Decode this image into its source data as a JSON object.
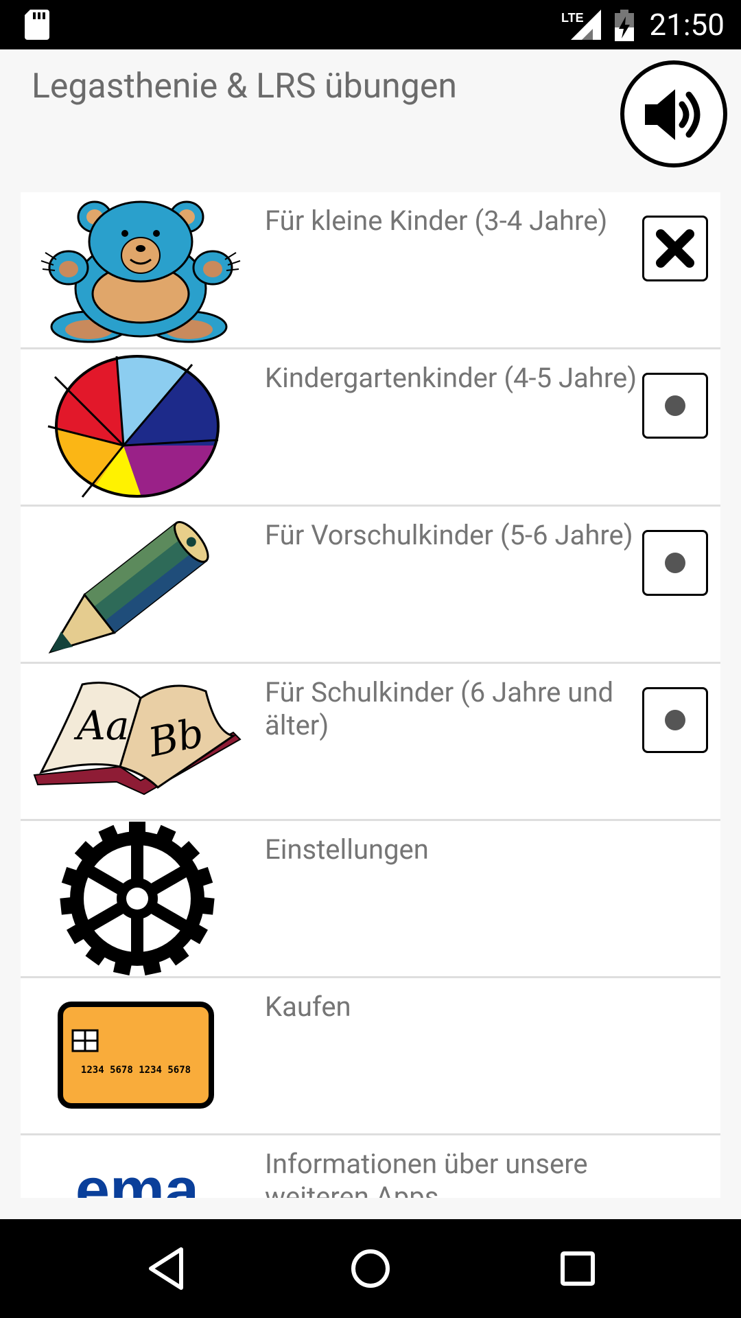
{
  "status_bar": {
    "time": "21:50",
    "network": "LTE"
  },
  "app": {
    "title": "Legasthenie & LRS übungen"
  },
  "menu": [
    {
      "label": "Für kleine Kinder (3-4 Jahre)",
      "icon": "teddy-bear-icon",
      "checkbox": "selected-x"
    },
    {
      "label": "Kindergartenkinder (4-5 Jahre)",
      "icon": "ball-icon",
      "checkbox": "dot"
    },
    {
      "label": "Für Vorschulkinder (5-6 Jahre)",
      "icon": "pencil-icon",
      "checkbox": "dot"
    },
    {
      "label": "Für Schulkinder (6 Jahre und älter)",
      "icon": "book-icon",
      "checkbox": "dot"
    },
    {
      "label": "Einstellungen",
      "icon": "gear-icon"
    },
    {
      "label": "Kaufen",
      "icon": "credit-card-icon",
      "card_number": "1234 5678 1234 5678"
    },
    {
      "label": "Informationen über unsere weiteren Apps",
      "icon": "ema-logo-icon",
      "logo_text": "ema"
    }
  ],
  "colors": {
    "teddy": "#2aa0cc",
    "card": "#f9ac3b",
    "text": "#757575",
    "logo": "#0a3f9a"
  }
}
